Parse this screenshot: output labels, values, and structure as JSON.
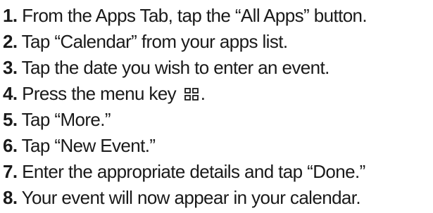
{
  "steps": [
    {
      "number": "1.",
      "text": "From the Apps Tab, tap the “All Apps” button."
    },
    {
      "number": "2.",
      "text": "Tap “Calendar” from your apps list."
    },
    {
      "number": "3.",
      "text": "Tap the date you wish to enter an event."
    },
    {
      "number": "4.",
      "text": "Press the menu key",
      "icon": "menu-key-icon",
      "after_icon": "."
    },
    {
      "number": "5.",
      "text": "Tap “More.”"
    },
    {
      "number": "6.",
      "text": "Tap “New Event.”"
    },
    {
      "number": "7.",
      "text": "Enter the appropriate details and tap “Done.”"
    },
    {
      "number": "8.",
      "text": "Your event will now appear in your calendar."
    }
  ],
  "colors": {
    "text": "#1a1a1a",
    "background": "#ffffff"
  }
}
